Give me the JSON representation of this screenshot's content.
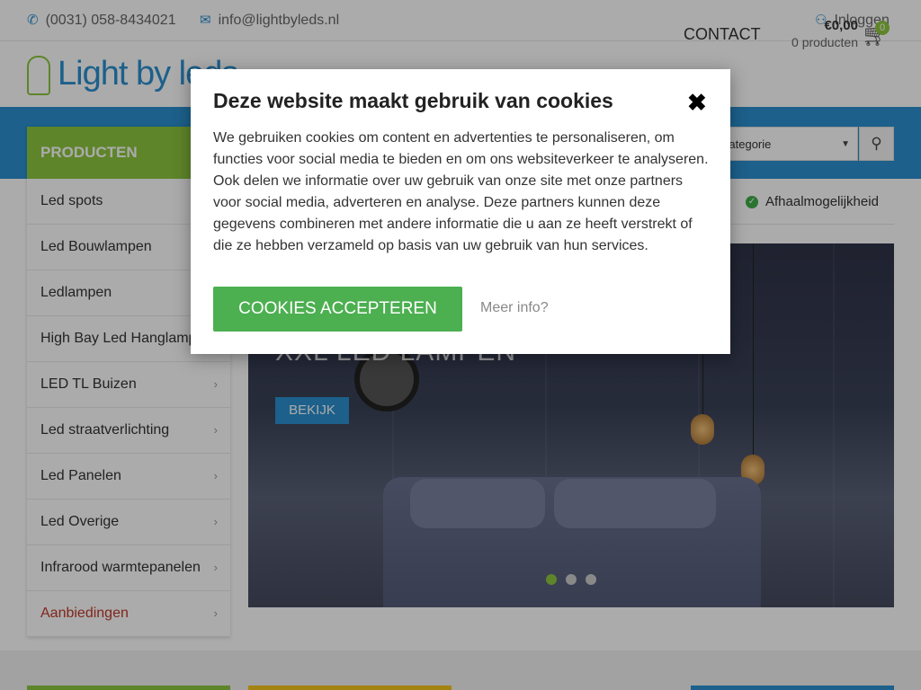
{
  "topbar": {
    "phone": "(0031) 058-8434021",
    "email": "info@lightbyleds.nl",
    "login": "Inloggen"
  },
  "header": {
    "logo_text": "Light by leds",
    "nav_contact": "CONTACT",
    "cart_total": "€0,00",
    "cart_count_text": "0 producten",
    "cart_badge": "0"
  },
  "search": {
    "category_placeholder": "Categorie"
  },
  "sidebar": {
    "heading": "PRODUCTEN",
    "items": [
      {
        "label": "Led spots"
      },
      {
        "label": "Led Bouwlampen"
      },
      {
        "label": "Ledlampen"
      },
      {
        "label": "High Bay Led Hanglampen"
      },
      {
        "label": "LED TL Buizen"
      },
      {
        "label": "Led straatverlichting"
      },
      {
        "label": "Led Panelen"
      },
      {
        "label": "Led Overige"
      },
      {
        "label": "Infrarood warmtepanelen"
      },
      {
        "label": "Aanbiedingen"
      }
    ]
  },
  "usp": {
    "pickup": "Afhaalmogelijkheid"
  },
  "hero": {
    "title": "XXL LED LAMPEN",
    "button": "BEKIJK",
    "slides": 3,
    "active_slide": 1
  },
  "cookie_modal": {
    "title": "Deze website maakt gebruik van cookies",
    "close_symbol": "✖",
    "body": "We gebruiken cookies om content en advertenties te personaliseren, om functies voor social media te bieden en om ons websiteverkeer te analyseren. Ook delen we informatie over uw gebruik van onze site met onze partners voor social media, adverteren en analyse. Deze partners kunnen deze gegevens combineren met andere informatie die u aan ze heeft verstrekt of die ze hebben verzameld op basis van uw gebruik van hun services.",
    "accept_label": "COOKIES ACCEPTEREN",
    "more_info_label": "Meer info?"
  },
  "colors": {
    "brand_blue": "#2a8fcf",
    "brand_green": "#8cc63f",
    "accept_green": "#4caf50",
    "offer_red": "#c0392b"
  },
  "icons": [
    "phone-icon",
    "mail-icon",
    "user-icon",
    "cart-icon",
    "search-icon",
    "check-icon",
    "chevron-right-icon",
    "close-icon"
  ]
}
